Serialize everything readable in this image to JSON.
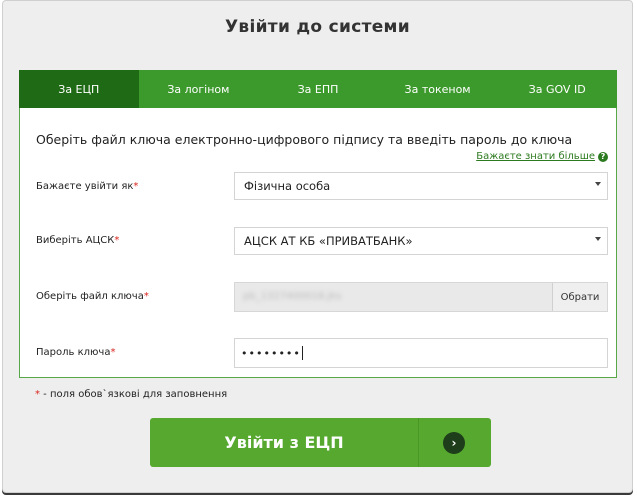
{
  "dialog": {
    "title": "Увійти до системи"
  },
  "tabs": [
    {
      "label": "За ЕЦП",
      "active": true
    },
    {
      "label": "За логіном",
      "active": false
    },
    {
      "label": "За ЕПП",
      "active": false
    },
    {
      "label": "За токеном",
      "active": false
    },
    {
      "label": "За GOV ID",
      "active": false
    }
  ],
  "panel": {
    "instruction": "Оберіть файл ключа електронно-цифрового підпису та введіть пароль до ключа",
    "more_link": "Бажаєте знати більше",
    "fields": {
      "login_as": {
        "label": "Бажаєте увійти як",
        "value": "Фізична особа"
      },
      "acsk": {
        "label": "Виберіть АЦСК",
        "value": "АЦСК АТ КБ «ПРИВАТБАНК»"
      },
      "key_file": {
        "label": "Оберіть файл ключа",
        "value": "pb_1327400018.jks",
        "button": "Обрати"
      },
      "password": {
        "label": "Пароль ключа",
        "value": "••••••••"
      }
    },
    "required_mark": "*"
  },
  "note": {
    "mark": "*",
    "text": " - поля обов`язкові для заповнення"
  },
  "submit": {
    "label": "Увійти з ЕЦП"
  },
  "colors": {
    "tab_bar": "#3c9a2c",
    "tab_active": "#1f6a14",
    "button": "#56a82f",
    "required": "#d8241e"
  }
}
